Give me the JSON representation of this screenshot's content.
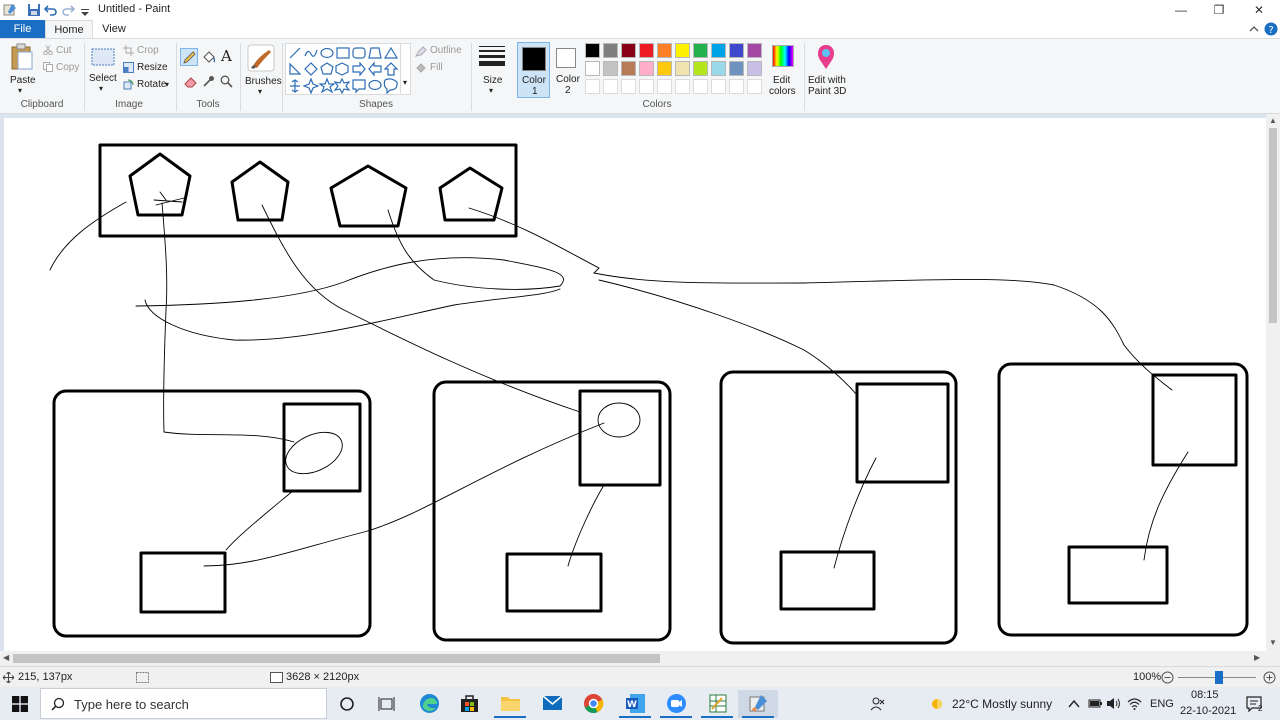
{
  "window": {
    "title": "Untitled - Paint",
    "minimize": "—",
    "maximize": "❐",
    "close": "✕"
  },
  "tabs": {
    "file": "File",
    "home": "Home",
    "view": "View"
  },
  "ribbon": {
    "clipboard": {
      "paste": "Paste",
      "cut": "Cut",
      "copy": "Copy",
      "label": "Clipboard"
    },
    "image": {
      "select": "Select",
      "crop": "Crop",
      "resize": "Resize",
      "rotate": "Rotate",
      "label": "Image"
    },
    "tools": {
      "label": "Tools",
      "text_glyph": "A"
    },
    "brushes": {
      "label": "Brushes"
    },
    "shapes": {
      "outline": "Outline",
      "fill": "Fill",
      "label": "Shapes"
    },
    "size": {
      "label": "Size"
    },
    "color1": {
      "line1": "Color",
      "line2": "1"
    },
    "color2": {
      "line1": "Color",
      "line2": "2"
    },
    "colors_label": "Colors",
    "edit_colors": {
      "line1": "Edit",
      "line2": "colors"
    },
    "paint3d": {
      "line1": "Edit with",
      "line2": "Paint 3D"
    },
    "palette_row1": [
      "#000000",
      "#7f7f7f",
      "#880015",
      "#ed1c24",
      "#ff7f27",
      "#fff200",
      "#22b14c",
      "#00a2e8",
      "#3f48cc",
      "#a349a4"
    ],
    "palette_row2": [
      "#ffffff",
      "#c3c3c3",
      "#b97a57",
      "#ffaec9",
      "#ffc90e",
      "#efe4b0",
      "#b5e61d",
      "#99d9ea",
      "#7092be",
      "#c8bfe7"
    ]
  },
  "status": {
    "cursor_pos": "215, 137px",
    "canvas_size": "3628 × 2120px",
    "zoom": "100%"
  },
  "taskbar": {
    "search_placeholder": "Type here to search",
    "weather": "22°C  Mostly sunny",
    "lang": "ENG",
    "time": "08:15",
    "date": "22-10-2021",
    "notif_count": "2"
  }
}
